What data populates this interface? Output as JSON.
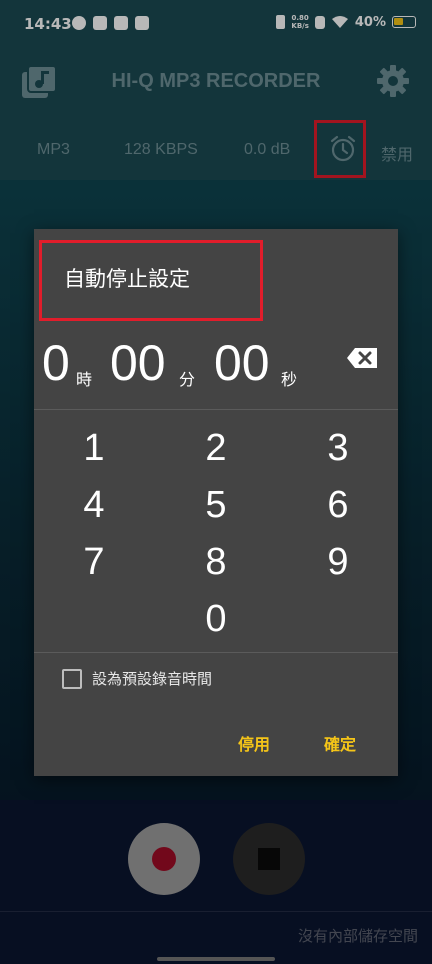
{
  "status_bar": {
    "time": "14:43",
    "net_speed_value": "0.80",
    "net_speed_unit": "KB/s",
    "battery": "40%"
  },
  "app_bar": {
    "title": "HI-Q MP3 RECORDER",
    "left_icon": "music-library-icon",
    "right_icon": "gear-icon"
  },
  "info_bar": {
    "format": "MP3",
    "bitrate": "128 KBPS",
    "gain": "0.0 dB",
    "alarm_icon": "alarm-clock-icon",
    "timer_state": "禁用"
  },
  "dialog": {
    "title": "自動停止設定",
    "hours": "0",
    "hours_unit": "時",
    "minutes": "00",
    "minutes_unit": "分",
    "seconds": "00",
    "seconds_unit": "秒",
    "keys": [
      "1",
      "2",
      "3",
      "4",
      "5",
      "6",
      "7",
      "8",
      "9",
      "0"
    ],
    "checkbox_label": "設為預設錄音時間",
    "checkbox_checked": false,
    "disable_button": "停用",
    "ok_button": "確定"
  },
  "footer": {
    "storage_message": "沒有內部儲存空間"
  },
  "colors": {
    "accent": "#f5c518",
    "highlight_box": "#e11d2b",
    "dialog_bg": "#444444"
  }
}
